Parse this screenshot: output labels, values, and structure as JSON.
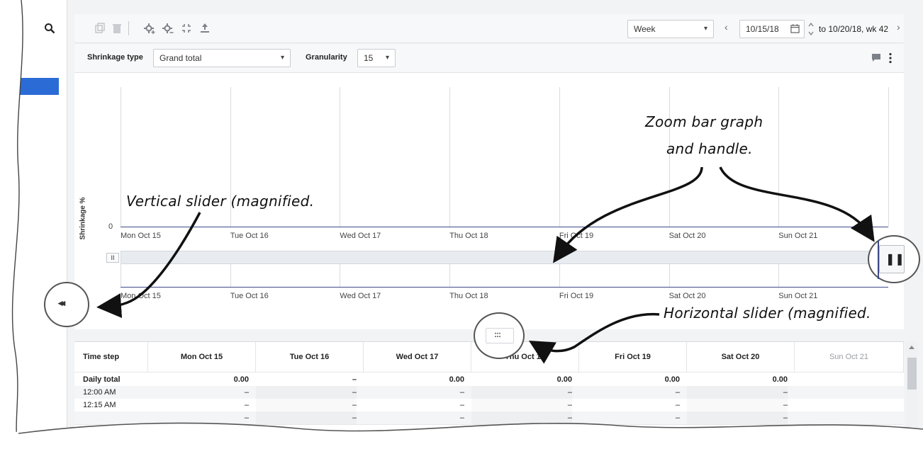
{
  "toolbar": {
    "period_select": "Week",
    "date_value": "10/15/18",
    "range_text": "to 10/20/18, wk 42",
    "prev_label": "‹",
    "next_label": "›"
  },
  "filters": {
    "shrinkage_type_label": "Shrinkage type",
    "shrinkage_type_value": "Grand total",
    "granularity_label": "Granularity",
    "granularity_value": "15"
  },
  "chart_data": {
    "type": "line",
    "ylabel": "Shrinkage %",
    "y_tick_zero": "0",
    "categories": [
      "Mon Oct 15",
      "Tue Oct 16",
      "Wed Oct 17",
      "Thu Oct 18",
      "Fri Oct 19",
      "Sat Oct 20",
      "Sun Oct 21"
    ],
    "values": [
      0,
      0,
      0,
      0,
      0,
      0,
      0
    ]
  },
  "table": {
    "headers": [
      "Time step",
      "Mon Oct 15",
      "Tue Oct 16",
      "Wed Oct 17",
      "Thu Oct 18",
      "Fri Oct 19",
      "Sat Oct 20",
      "Sun Oct 21"
    ],
    "rows": [
      {
        "label": "Daily total",
        "cells": [
          "0.00",
          "–",
          "0.00",
          "0.00",
          "0.00",
          "0.00",
          ""
        ]
      },
      {
        "label": "12:00 AM",
        "cells": [
          "–",
          "–",
          "–",
          "–",
          "–",
          "–",
          ""
        ]
      },
      {
        "label": "12:15 AM",
        "cells": [
          "–",
          "–",
          "–",
          "–",
          "–",
          "–",
          ""
        ]
      },
      {
        "label": "",
        "cells": [
          "–",
          "–",
          "–",
          "–",
          "–",
          "–",
          ""
        ]
      }
    ]
  },
  "annotations": {
    "zoom_line1": "Zoom bar graph",
    "zoom_line2": "and handle.",
    "vertical": "Vertical slider (magnified.",
    "horizontal": "Horizontal slider (magnified."
  },
  "icons": {
    "collapse_glyph": "◂◂",
    "zoom_handle_glyph": "❚❚",
    "zoom_left_glyph": "II",
    "drag_glyph": ":::"
  }
}
